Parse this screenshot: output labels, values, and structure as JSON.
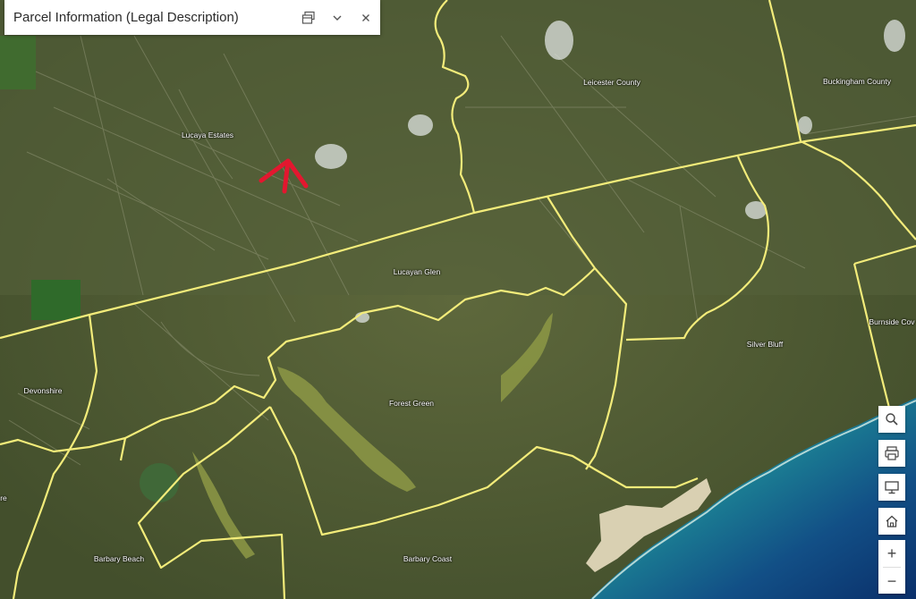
{
  "panel": {
    "title": "Parcel Information (Legal Description)",
    "buttons": [
      "dock-icon",
      "chevron-down-icon",
      "close-icon"
    ]
  },
  "map": {
    "colors": {
      "land": "#4d5a33",
      "land_light": "#6b7446",
      "boundary": "#f3ec7a",
      "ocean_shallow": "#2ea89c",
      "ocean_deep": "#0c3a78",
      "beach": "#d9d0b2",
      "wetland": "#8a9545",
      "arrow": "#e3172f"
    },
    "labels": {
      "lucaya_estates": "Lucaya Estates",
      "leicester_county": "Leicester County",
      "buckingham_county": "Buckingham County",
      "lucayan_glen": "Lucayan Glen",
      "burnside_cove": "Burnside Cov",
      "silver_bluff": "Silver Bluff",
      "devonshire": "Devonshire",
      "forest_green": "Forest Green",
      "barbary_beach": "Barbary Beach",
      "barbary_coast": "Barbary Coast",
      "edge_fragment": "re"
    }
  },
  "tools": {
    "search": "search-icon",
    "print": "print-icon",
    "screen": "monitor-icon",
    "home": "home-icon",
    "zoom_in": "+",
    "zoom_out": "−"
  }
}
